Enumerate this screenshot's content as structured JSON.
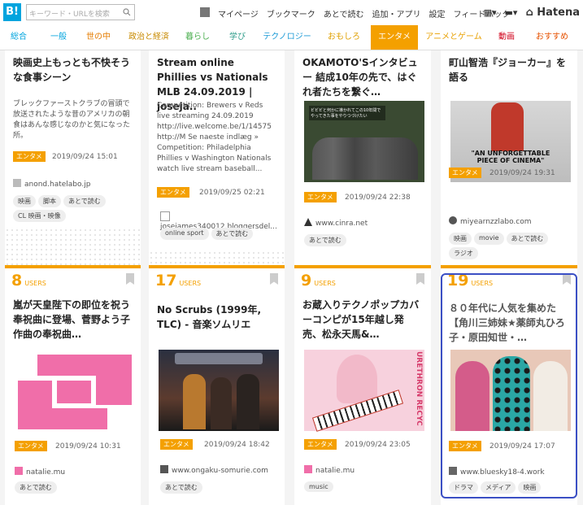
{
  "header": {
    "logo": "B!",
    "search_placeholder": "キーワード・URLを検索",
    "nav": [
      "マイページ",
      "ブックマーク",
      "あとで読む",
      "追加・アプリ",
      "設定",
      "フィードバック"
    ],
    "brand": "Hatena"
  },
  "categories": [
    "総合",
    "一般",
    "世の中",
    "政治と経済",
    "暮らし",
    "学び",
    "テクノロジー",
    "おもしろ",
    "エンタメ",
    "アニメとゲーム",
    "動画",
    "おすすめ"
  ],
  "active_category": "エンタメ",
  "row1": [
    {
      "title": "映画史上もっとも不快そうな食事シーン",
      "desc": "ブレックファーストクラブの冒頭で放送されたような昔のアメリカの朝食はあんな感じなのかと気になった所。",
      "badge": "エンタメ",
      "date": "2019/09/24 15:01",
      "site": "anond.hatelabo.jp",
      "tags": [
        "映画",
        "脚本",
        "あとで読む",
        "CL 映画・映像"
      ]
    },
    {
      "title": "Stream online Phillies vs Nationals MLB 24.09.2019 | joseja..",
      "desc": "Competition: Brewers v Reds live streaming 24.09.2019 http://live.welcome.be/1/14575 http://M Se naeste indlæg » Competition: Philadelphia Phillies v Washington Nationals watch live stream baseball...",
      "badge": "エンタメ",
      "date": "2019/09/25 02:21",
      "site": "josejames340012.bloggersdel...",
      "tags": [
        "online sport",
        "あとで読む"
      ]
    },
    {
      "title": "OKAMOTO'Sインタビュー 結成10年の先で、はぐれ者たちを繋ぐ…",
      "badge": "エンタメ",
      "date": "2019/09/24 22:38",
      "site": "www.cinra.net",
      "tags": [
        "あとで読む"
      ],
      "thumb_caption": "ビビビと何かに導かれてこの10年間でやってきた事をやりつづけたい"
    },
    {
      "title": "町山智浩『ジョーカー』を語る",
      "badge": "エンタメ",
      "date": "2019/09/24 19:31",
      "site": "miyearnzzlabo.com",
      "tags": [
        "映画",
        "movie",
        "あとで読む",
        "ラジオ"
      ],
      "thumb_text": "\"AN UNFORGETTABLE PIECE OF CINEMA\""
    }
  ],
  "row2": [
    {
      "users": "8",
      "users_label": "USERS",
      "title": "嵐が天皇陛下の即位を祝う奉祝曲に登場、菅野よう子作曲の奉祝曲…",
      "badge": "エンタメ",
      "date": "2019/09/24 10:31",
      "site": "natalie.mu",
      "tags": [
        "あとで読む"
      ]
    },
    {
      "users": "17",
      "users_label": "USERS",
      "title": "No Scrubs (1999年, TLC) - 音楽ソムリエ",
      "badge": "エンタメ",
      "date": "2019/09/24 18:42",
      "site": "www.ongaku-somurie.com",
      "tags": [
        "あとで読む"
      ]
    },
    {
      "users": "9",
      "users_label": "USERS",
      "title": "お蔵入りテクノポップカバーコンピが15年越し発売、松永天馬&…",
      "badge": "エンタメ",
      "date": "2019/09/24 23:05",
      "site": "natalie.mu",
      "tags": [
        "music"
      ],
      "thumb_text": "URETHRON RECYC"
    },
    {
      "users": "19",
      "users_label": "USERS",
      "title": "８０年代に人気を集めた【角川三姉妹★薬師丸ひろ子・原田知世・…",
      "badge": "エンタメ",
      "date": "2019/09/24 17:07",
      "site": "www.bluesky18-4.work",
      "tags": [
        "ドラマ",
        "メディア",
        "映画"
      ]
    }
  ]
}
